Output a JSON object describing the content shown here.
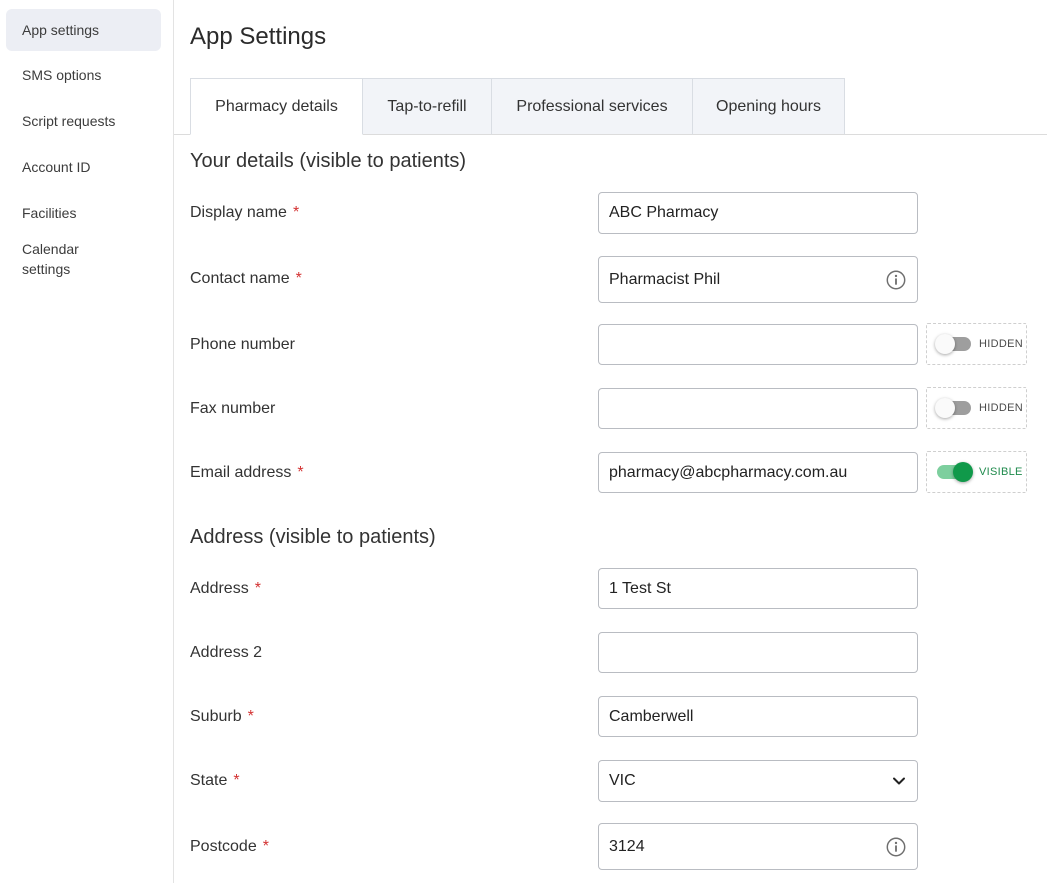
{
  "sidebar": {
    "items": [
      {
        "label": "App settings",
        "active": true
      },
      {
        "label": "SMS options"
      },
      {
        "label": "Script requests"
      },
      {
        "label": "Account ID"
      },
      {
        "label": "Facilities"
      },
      {
        "label": "Calendar settings"
      }
    ]
  },
  "page": {
    "title": "App Settings"
  },
  "tabs": [
    {
      "label": "Pharmacy details",
      "active": true
    },
    {
      "label": "Tap-to-refill"
    },
    {
      "label": "Professional services"
    },
    {
      "label": "Opening hours"
    }
  ],
  "details": {
    "title": "Your details (visible to patients)",
    "display_name": {
      "label": "Display name",
      "value": "ABC Pharmacy",
      "required": "*"
    },
    "contact_name": {
      "label": "Contact name",
      "value": "Pharmacist Phil",
      "required": "*",
      "icon": "info-icon"
    },
    "phone": {
      "label": "Phone number",
      "value": "",
      "visibility": "HIDDEN"
    },
    "fax": {
      "label": "Fax number",
      "value": "",
      "visibility": "HIDDEN"
    },
    "email": {
      "label": "Email address",
      "value": "pharmacy@abcpharmacy.com.au",
      "required": "*",
      "visibility": "VISIBLE"
    }
  },
  "address": {
    "title": "Address (visible to patients)",
    "address1": {
      "label": "Address",
      "value": "1 Test St",
      "required": "*"
    },
    "address2": {
      "label": "Address 2",
      "value": ""
    },
    "suburb": {
      "label": "Suburb",
      "value": "Camberwell",
      "required": "*"
    },
    "state": {
      "label": "State",
      "value": "VIC",
      "required": "*",
      "icon": "chevron-down-icon"
    },
    "postcode": {
      "label": "Postcode",
      "value": "3124",
      "required": "*",
      "icon": "info-icon"
    }
  },
  "colors": {
    "required": "#d33131",
    "toggle_on": "#10994a",
    "toggle_on_track": "#7dcf9e",
    "toggle_off_track": "#9e9e9e",
    "tab_inactive_bg": "#f2f4f8",
    "sidebar_active_bg": "#eceef4"
  }
}
